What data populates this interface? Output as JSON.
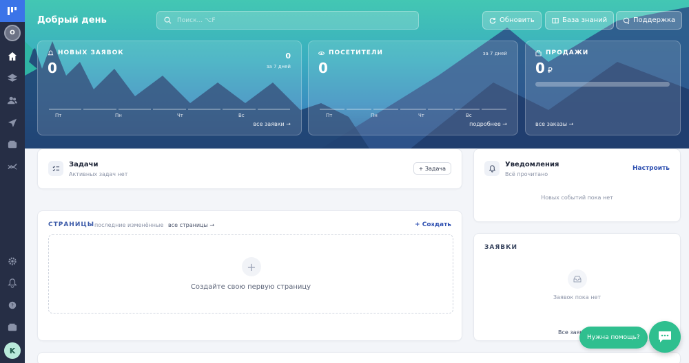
{
  "header": {
    "greeting": "Добрый день",
    "search_placeholder": "Поиск... ⌥F",
    "refresh_label": "Обновить",
    "kb_label": "База знаний",
    "support_label": "Поддержка"
  },
  "stats": {
    "leads": {
      "title": "НОВЫХ ЗАЯВОК",
      "value": "0",
      "right_value": "0",
      "period": "за 7 дней",
      "days": [
        "Пт",
        "Пн",
        "Чт",
        "Вс"
      ],
      "link": "все заявки →"
    },
    "visitors": {
      "title": "ПОСЕТИТЕЛИ",
      "value": "0",
      "period": "за 7 дней",
      "days": [
        "Пт",
        "Пн",
        "Чт",
        "Вс"
      ],
      "link": "подробнее →"
    },
    "sales": {
      "title": "ПРОДАЖИ",
      "value": "0",
      "currency": "₽",
      "link": "все заказы →"
    }
  },
  "tasks": {
    "title": "Задачи",
    "subtitle": "Активных задач нет",
    "add_label": "+ Задача"
  },
  "notifications": {
    "title": "Уведомления",
    "subtitle": "Всё прочитано",
    "configure": "Настроить",
    "empty": "Новых событий пока нет"
  },
  "pages": {
    "title": "СТРАНИЦЫ",
    "recent": "последние изменённые",
    "all": "все страницы →",
    "create": "Создать",
    "empty": "Создайте свою первую страницу"
  },
  "leads_panel": {
    "title": "ЗАЯВКИ",
    "empty": "Заявок пока нет",
    "all": "Все заяв"
  },
  "help": {
    "label": "Нужна помощь?"
  },
  "sidebar": {
    "top_avatar": "O",
    "user_initial": "K"
  },
  "colors": {
    "accent": "#2d4fb0",
    "help_green": "#2fbf8f",
    "sidebar": "#262e45"
  }
}
